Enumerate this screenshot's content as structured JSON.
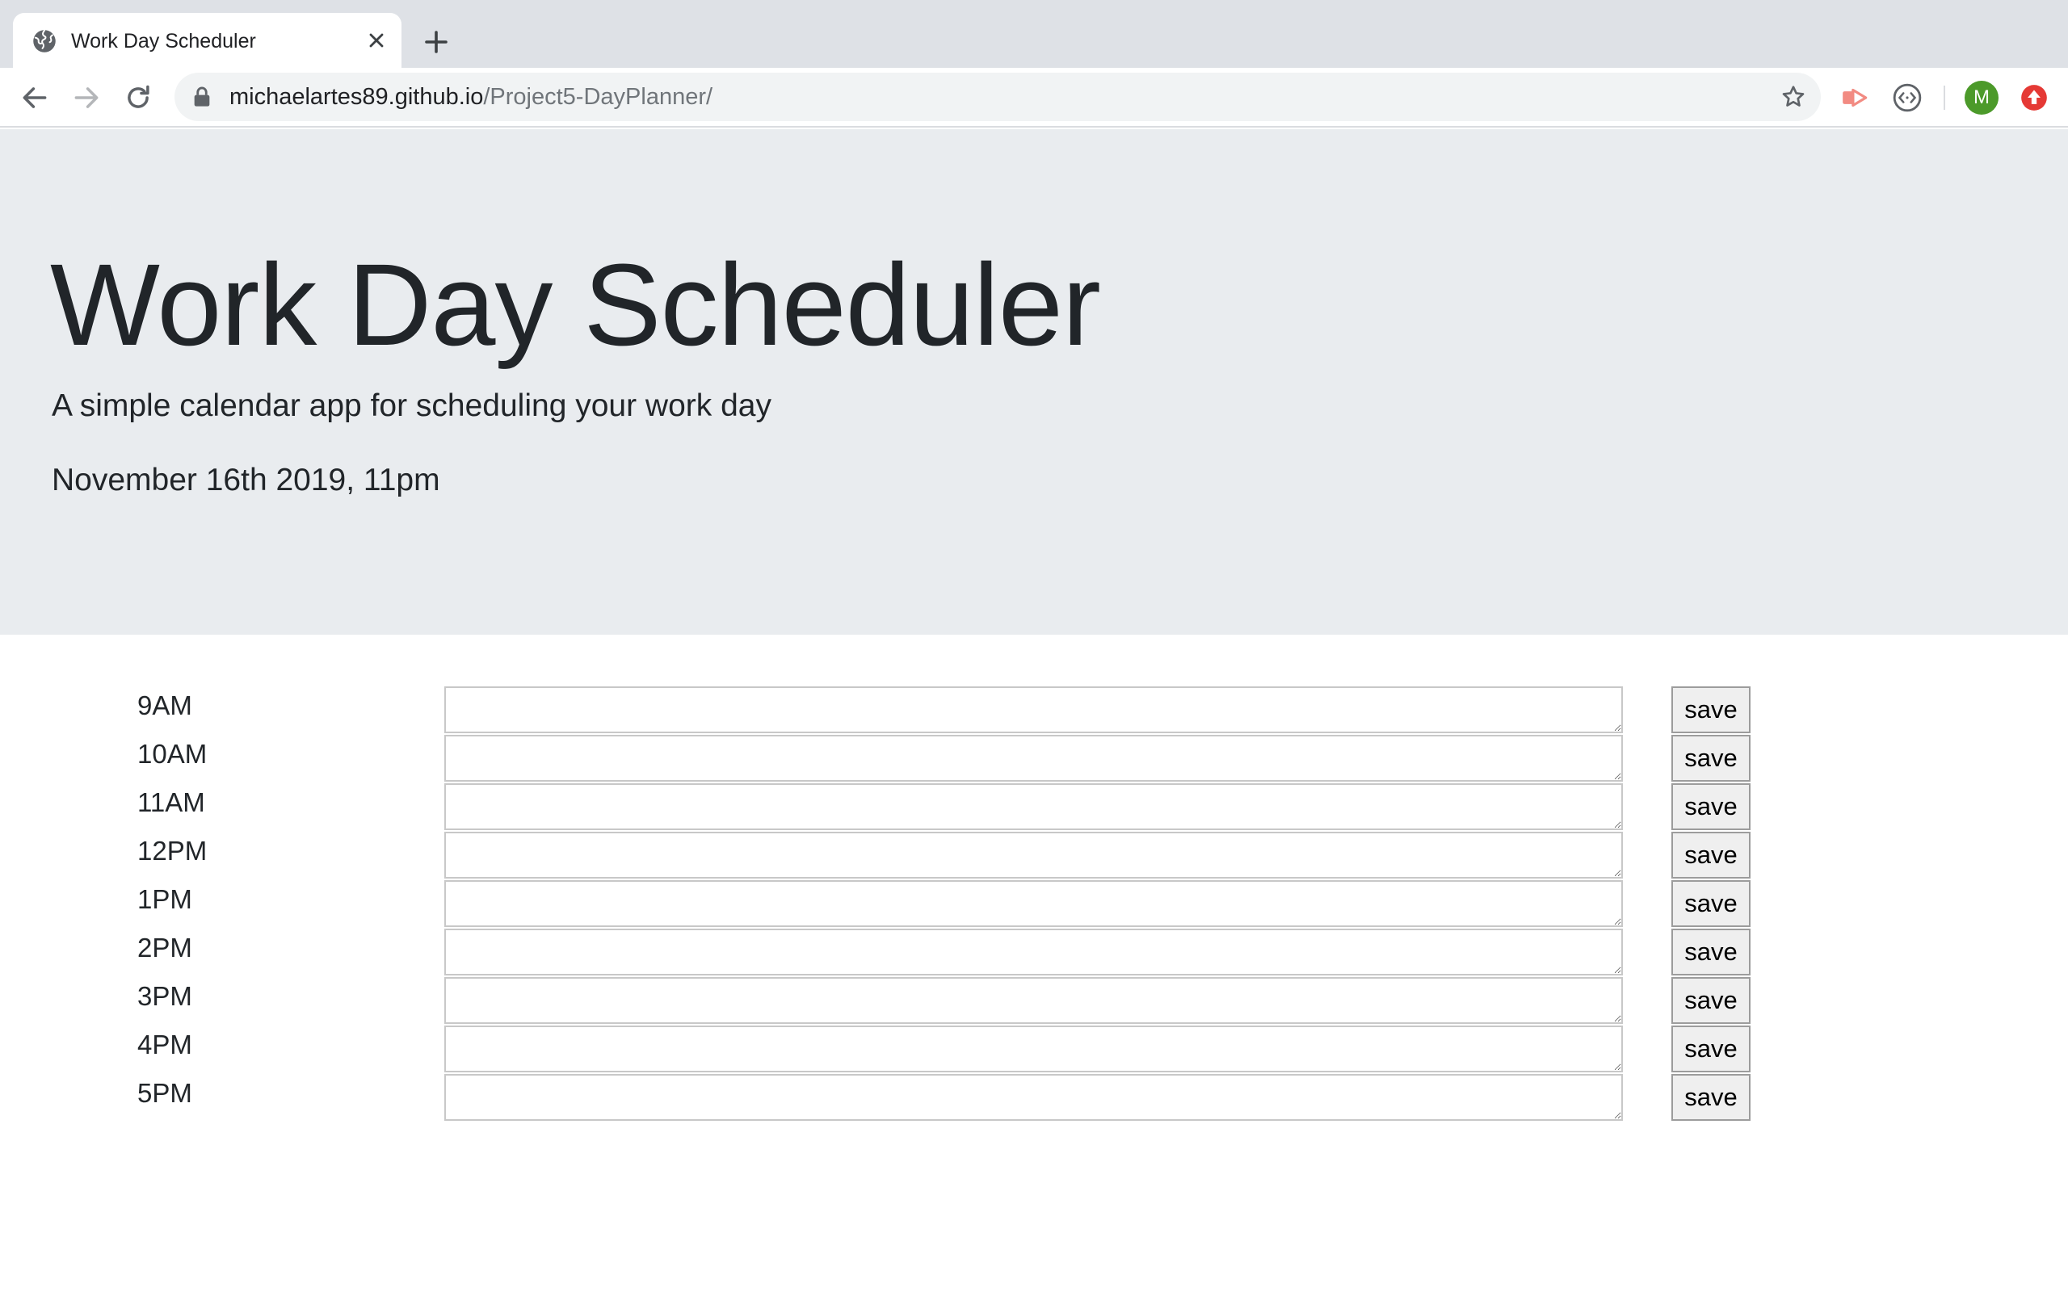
{
  "browser": {
    "tab_title": "Work Day Scheduler",
    "url_host": "michaelartes89.github.io",
    "url_path": "/Project5-DayPlanner/",
    "profile_initial": "M",
    "colors": {
      "tabstrip": "#dee1e6",
      "avatar": "#4c9a2a",
      "update_badge": "#e53935",
      "extension": "#f28b82"
    }
  },
  "header": {
    "title": "Work Day Scheduler",
    "lead": "A simple calendar app for scheduling your work day",
    "current_day": "November 16th 2019, 11pm"
  },
  "schedule": {
    "rows": [
      {
        "hour": "9AM",
        "value": "",
        "save_label": "save"
      },
      {
        "hour": "10AM",
        "value": "",
        "save_label": "save"
      },
      {
        "hour": "11AM",
        "value": "",
        "save_label": "save"
      },
      {
        "hour": "12PM",
        "value": "",
        "save_label": "save"
      },
      {
        "hour": "1PM",
        "value": "",
        "save_label": "save"
      },
      {
        "hour": "2PM",
        "value": "",
        "save_label": "save"
      },
      {
        "hour": "3PM",
        "value": "",
        "save_label": "save"
      },
      {
        "hour": "4PM",
        "value": "",
        "save_label": "save"
      },
      {
        "hour": "5PM",
        "value": "",
        "save_label": "save"
      }
    ]
  }
}
